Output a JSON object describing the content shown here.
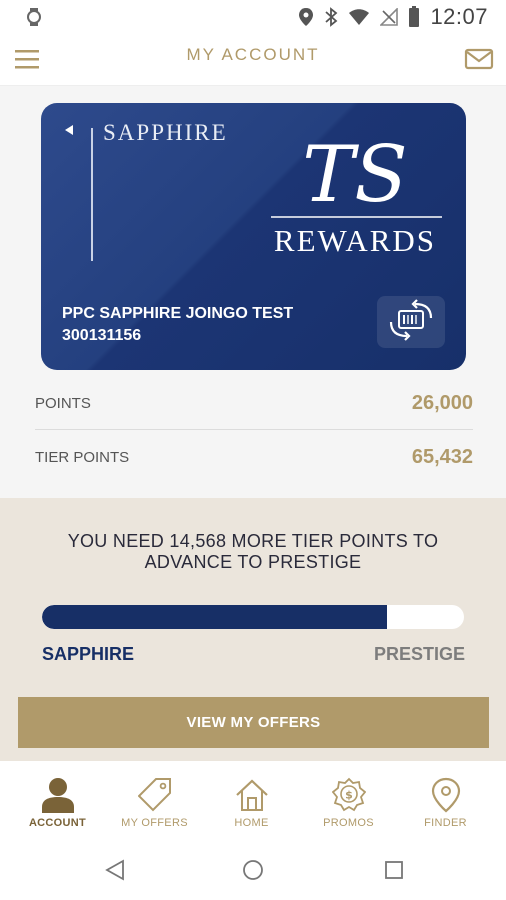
{
  "status_bar": {
    "time": "12:07"
  },
  "app_bar": {
    "title": "MY ACCOUNT"
  },
  "card": {
    "tier_name": "SAPPHIRE",
    "logo_monogram": "TS",
    "logo_text": "REWARDS",
    "holder_name": "PPC SAPPHIRE JOINGO TEST",
    "member_number": "300131156",
    "card_color": "#1e3a7a"
  },
  "balances": [
    {
      "label": "POINTS",
      "value": "26,000"
    },
    {
      "label": "TIER POINTS",
      "value": "65,432"
    }
  ],
  "progress": {
    "message": "YOU NEED 14,568 MORE TIER POINTS TO ADVANCE TO PRESTIGE",
    "fraction": 0.818,
    "current_tier": "SAPPHIRE",
    "next_tier": "PRESTIGE"
  },
  "offers_button": {
    "label": "VIEW MY OFFERS"
  },
  "bottom_nav": [
    {
      "label": "ACCOUNT",
      "icon": "person-icon",
      "active": true
    },
    {
      "label": "MY OFFERS",
      "icon": "tag-icon",
      "active": false
    },
    {
      "label": "HOME",
      "icon": "home-icon",
      "active": false
    },
    {
      "label": "PROMOS",
      "icon": "promo-badge-icon",
      "active": false
    },
    {
      "label": "FINDER",
      "icon": "location-pin-icon",
      "active": false
    }
  ],
  "colors": {
    "accent_gold": "#b09a6a",
    "navy": "#172f66",
    "progress_bg": "#ebe5dc"
  }
}
